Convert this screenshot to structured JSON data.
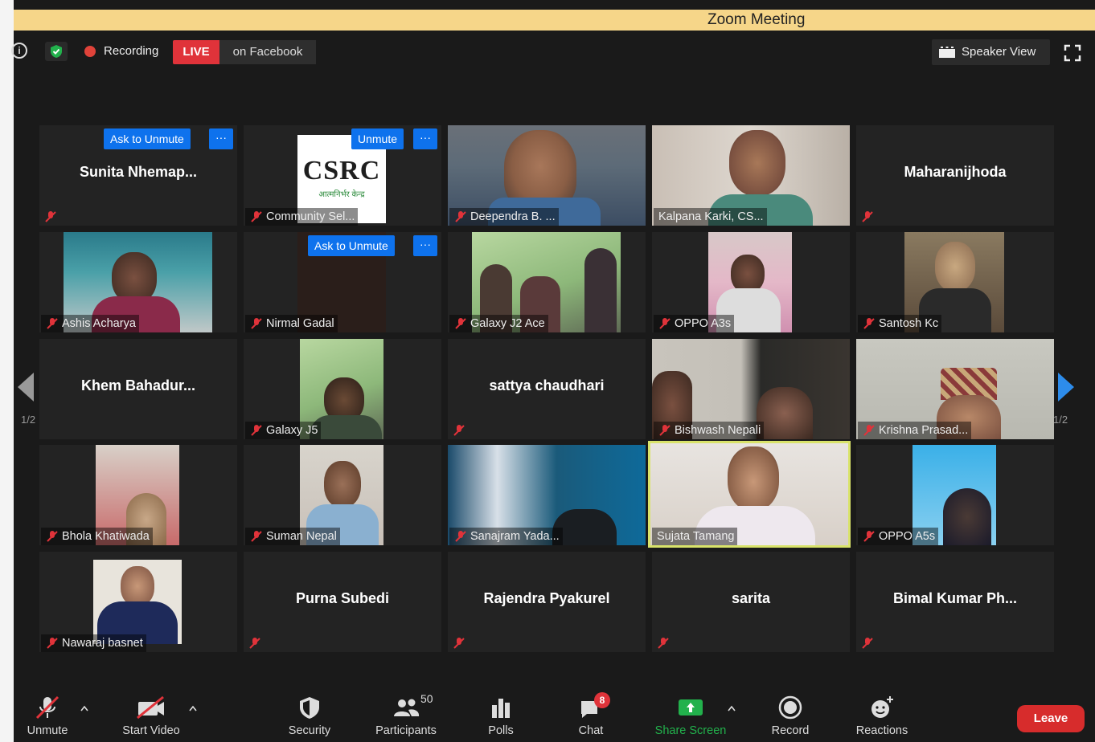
{
  "window_title": "Zoom Meeting",
  "topbar": {
    "recording_label": "Recording",
    "live_badge": "LIVE",
    "live_destination": "on Facebook",
    "view_button": "Speaker View"
  },
  "ask_to_unmute": "Ask to Unmute",
  "unmute": "Unmute",
  "more": "···",
  "csrc_logo": {
    "main": "CSRC",
    "sub": "आत्मनिर्भर केन्द्र"
  },
  "tiles": [
    {
      "name": "Sunita  Nhemap...",
      "label": ""
    },
    {
      "name": "",
      "label": "Community Sel..."
    },
    {
      "name": "",
      "label": "Deependra B. ..."
    },
    {
      "name": "",
      "label": "Kalpana Karki, CS..."
    },
    {
      "name": "Maharanijhoda",
      "label": ""
    },
    {
      "name": "",
      "label": "Ashis Acharya"
    },
    {
      "name": "",
      "label": "Nirmal Gadal"
    },
    {
      "name": "",
      "label": "Galaxy J2 Ace"
    },
    {
      "name": "",
      "label": "OPPO A3s"
    },
    {
      "name": "",
      "label": "Santosh Kc"
    },
    {
      "name": "Khem  Bahadur...",
      "label": ""
    },
    {
      "name": "",
      "label": "Galaxy J5"
    },
    {
      "name": "sattya chaudhari",
      "label": ""
    },
    {
      "name": "",
      "label": "Bishwash Nepali"
    },
    {
      "name": "",
      "label": "Krishna Prasad..."
    },
    {
      "name": "",
      "label": "Bhola Khatiwada"
    },
    {
      "name": "",
      "label": "Suman Nepal"
    },
    {
      "name": "",
      "label": "Sanajram Yada..."
    },
    {
      "name": "",
      "label": "Sujata Tamang"
    },
    {
      "name": "",
      "label": "OPPO A5s"
    },
    {
      "name": "",
      "label": "Nawaraj basnet"
    },
    {
      "name": "Purna Subedi",
      "label": ""
    },
    {
      "name": "Rajendra Pyakurel",
      "label": ""
    },
    {
      "name": "sarita",
      "label": ""
    },
    {
      "name": "Bimal  Kumar  Ph...",
      "label": ""
    }
  ],
  "pagination": {
    "left": "1/2",
    "right": "1/2"
  },
  "toolbar": {
    "unmute": "Unmute",
    "start_video": "Start Video",
    "security": "Security",
    "participants": "Participants",
    "participants_count": "50",
    "polls": "Polls",
    "chat": "Chat",
    "chat_badge": "8",
    "share_screen": "Share Screen",
    "record": "Record",
    "reactions": "Reactions",
    "leave": "Leave"
  },
  "colors": {
    "title_bar": "#f6d689",
    "live_red": "#e0333a",
    "button_blue": "#0e72ed",
    "share_green": "#22b14c",
    "active_speaker": "#d9e36a",
    "leave_red": "#d72c2c"
  }
}
